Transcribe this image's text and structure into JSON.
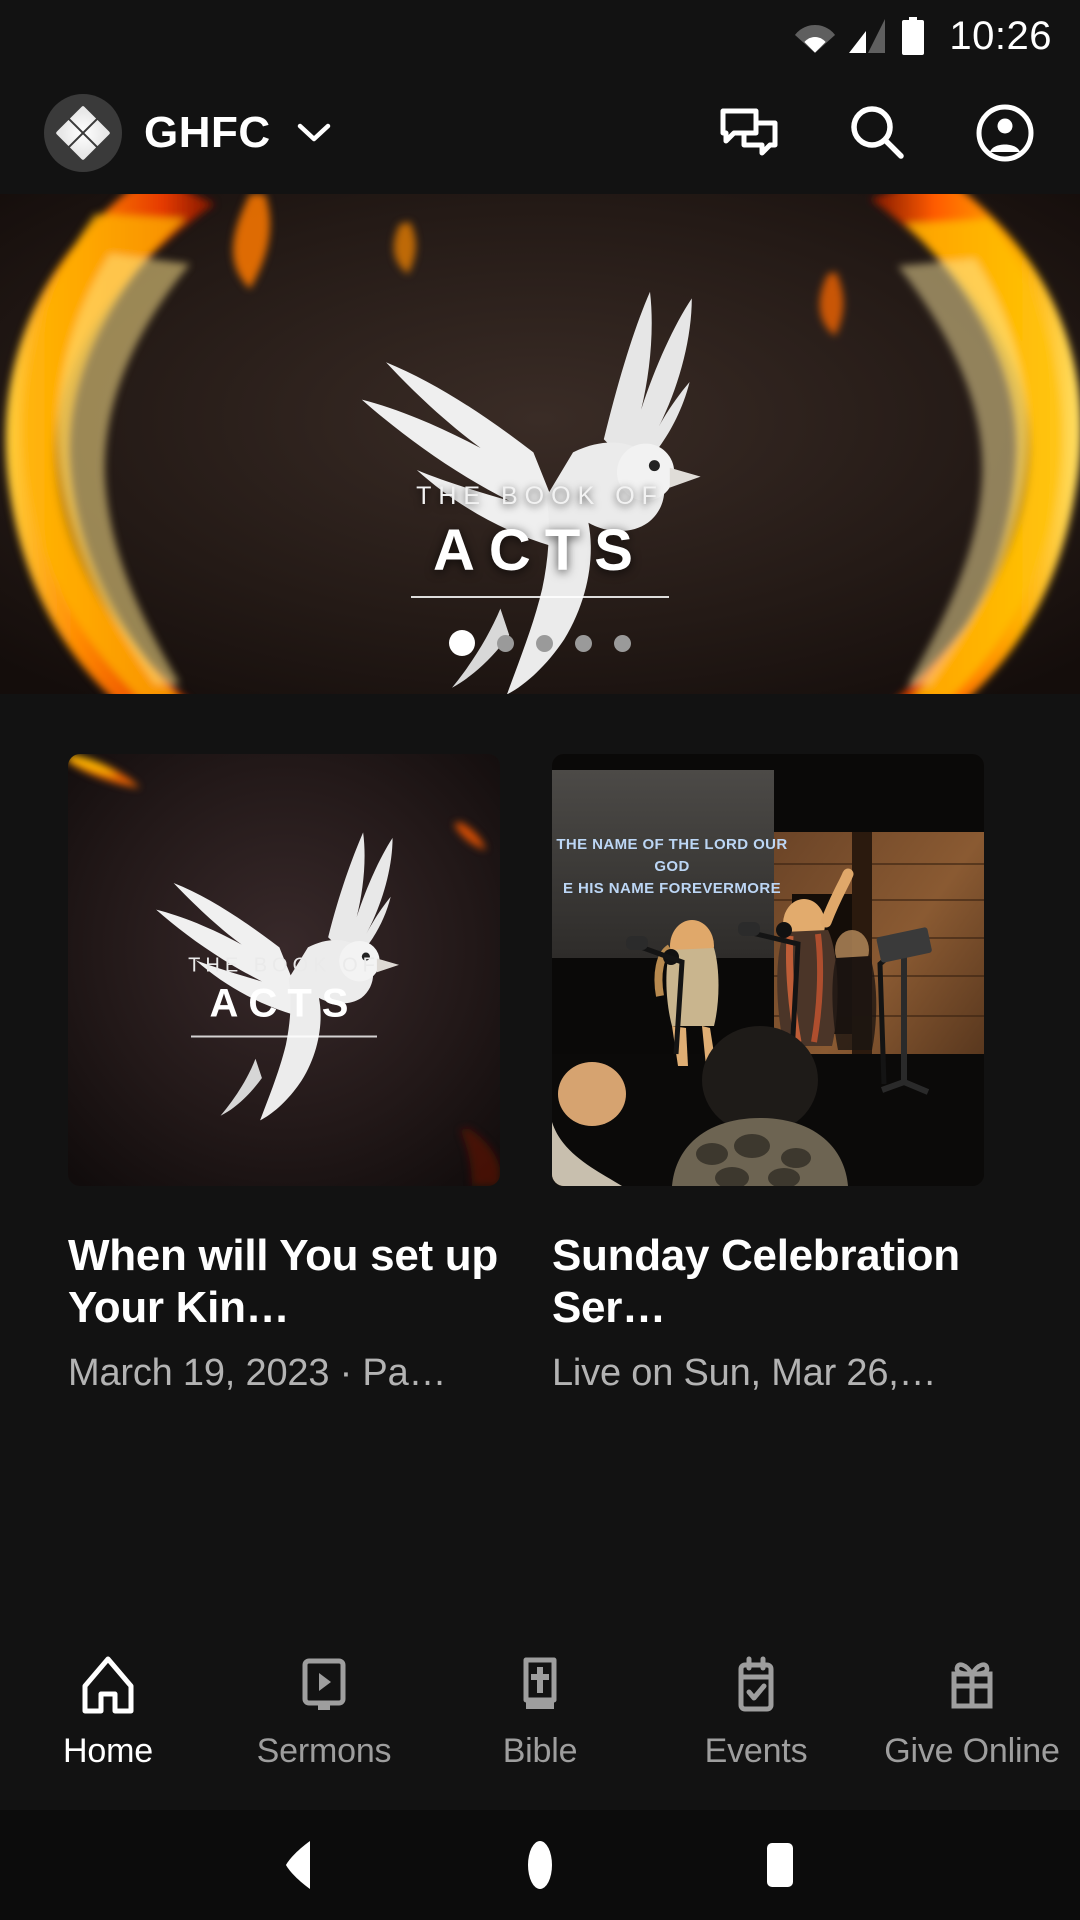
{
  "status_bar": {
    "time": "10:26",
    "icons": [
      "wifi-icon",
      "cellular-signal-icon",
      "battery-icon"
    ]
  },
  "header": {
    "logo_icon": "church-diamond-logo-icon",
    "church_name": "GHFC",
    "dropdown_icon": "chevron-down-icon",
    "actions": [
      {
        "name": "messages-icon",
        "label": "Messages"
      },
      {
        "name": "search-icon",
        "label": "Search"
      },
      {
        "name": "account-icon",
        "label": "Account"
      }
    ]
  },
  "hero": {
    "slide_caption_small": "THE BOOK OF",
    "slide_caption_big": "ACTS",
    "total_slides": 5,
    "active_slide": 1,
    "dots": [
      true,
      false,
      false,
      false,
      false
    ]
  },
  "cards": [
    {
      "thumb_caption_small": "THE BOOK OF",
      "thumb_caption_big": "ACTS",
      "title": "When will You set up Your Kin…",
      "subtitle": "March 19, 2023 · Pa…"
    },
    {
      "lyrics_line_1": "THE NAME OF THE LORD OUR",
      "lyrics_line_2": "GOD",
      "lyrics_line_3": "E HIS NAME FOREVERMORE",
      "title": "Sunday Celebration Ser…",
      "subtitle": "Live on Sun, Mar 26,…"
    }
  ],
  "tabs": [
    {
      "label": "Home",
      "icon": "home-church-icon",
      "active": true
    },
    {
      "label": "Sermons",
      "icon": "video-play-icon",
      "active": false
    },
    {
      "label": "Bible",
      "icon": "bible-book-icon",
      "active": false
    },
    {
      "label": "Events",
      "icon": "calendar-check-icon",
      "active": false
    },
    {
      "label": "Give Online",
      "icon": "gift-icon",
      "active": false
    }
  ],
  "system_nav": {
    "back": "back-triangle-icon",
    "home": "home-circle-icon",
    "recents": "recents-square-icon"
  },
  "colors": {
    "background": "#121212",
    "surface": "#1a1a1a",
    "text_primary": "#ffffff",
    "text_secondary": "#b3b3b3",
    "tab_inactive": "#9e9e9e",
    "flame_orange": "#ff6a00",
    "flame_yellow": "#ffc400"
  }
}
